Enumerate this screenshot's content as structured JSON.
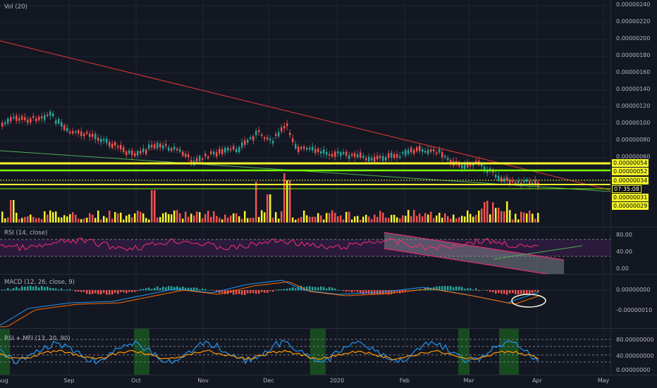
{
  "main_pane": {
    "title": "Vol (20)",
    "price_ticks": [
      "0.00000240",
      "0.00000220",
      "0.00000200",
      "0.00000180",
      "0.00000160",
      "0.00000140",
      "0.00000120",
      "0.00000100",
      "0.00000080",
      "0.00000060"
    ],
    "tags": [
      "0.00000054",
      "0.00000052",
      "0.00000034",
      "07:35:08",
      "0.00000031",
      "0.00000029"
    ]
  },
  "rsi_pane": {
    "title": "RSI (14, close)",
    "ticks": [
      "80.00",
      "40.00",
      "0.00"
    ]
  },
  "macd_pane": {
    "title": "MACD (12, 26, close, 9)",
    "ticks": [
      "0.00000000",
      "-0.00000010"
    ]
  },
  "mfi_pane": {
    "title": "RSI + MFI (13, 20, 90)",
    "ticks": [
      "80.00000000",
      "40.00000000",
      "0.00000000"
    ]
  },
  "time_axis": {
    "labels": [
      "Aug",
      "Sep",
      "Oct",
      "Nov",
      "Dec",
      "2020",
      "Feb",
      "Mar",
      "Apr",
      "May"
    ]
  },
  "colors": {
    "background": "#131722",
    "up": "#26a69a",
    "down": "#ef5350",
    "volume_up": "#f5f52a",
    "volume_down": "#ef5350",
    "trendline_red": "#e53935",
    "trendline_green": "#4caf50",
    "support_yellow": "#f5f52a",
    "rsi_line": "#ff2d6f",
    "macd_line": "#2196f3",
    "signal_line": "#ff6d00",
    "mfi_blue": "#2196f3",
    "mfi_orange": "#ff9800"
  }
}
